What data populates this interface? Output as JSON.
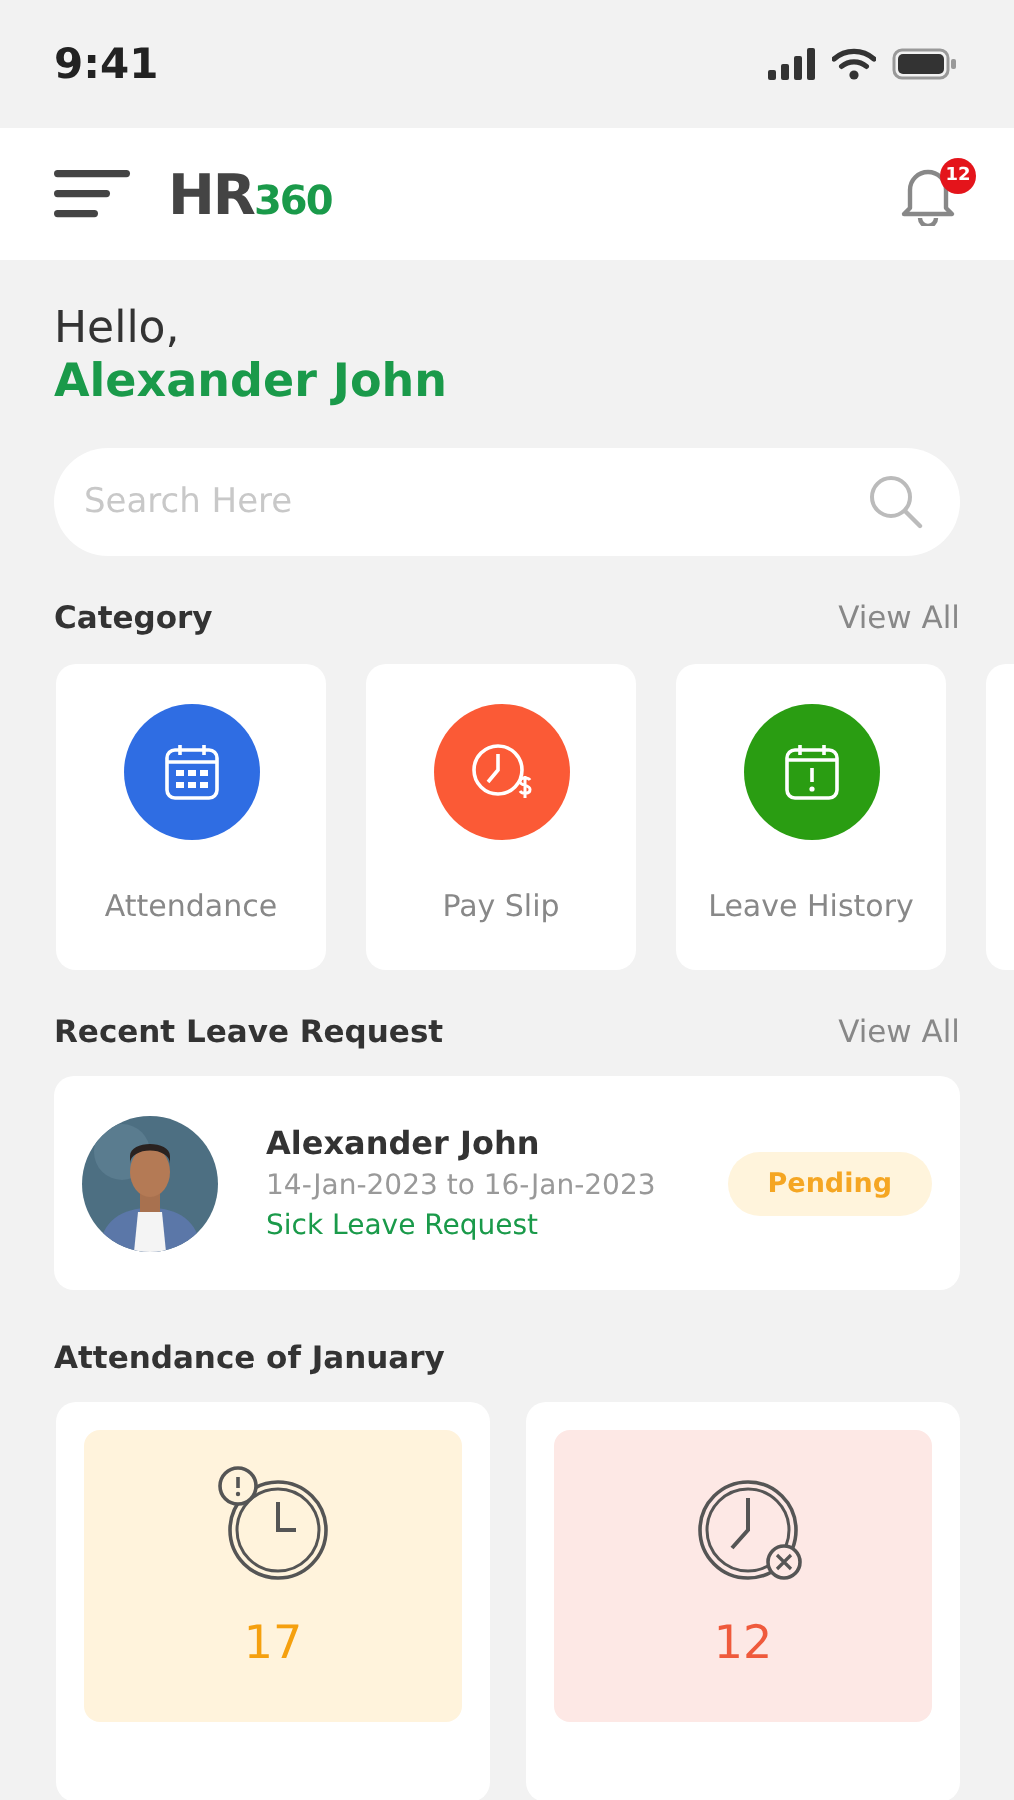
{
  "status_bar": {
    "time": "9:41"
  },
  "header": {
    "logo": {
      "text_1": "HR",
      "text_2": "360"
    },
    "notifications": "12"
  },
  "greeting": {
    "hello": "Hello,",
    "name": "Alexander John"
  },
  "search": {
    "placeholder": "Search Here"
  },
  "category": {
    "title": "Category",
    "view_all": "View All",
    "items": [
      {
        "label": "Attendance",
        "kind": "calendar",
        "color": "#2f6de3"
      },
      {
        "label": "Pay Slip",
        "kind": "payclock",
        "color": "#fb5a36"
      },
      {
        "label": "Leave History",
        "kind": "alertcal",
        "color": "#2a9d12"
      }
    ]
  },
  "recent_leave": {
    "title": "Recent Leave Request",
    "view_all": "View All",
    "requests": [
      {
        "name": "Alexander John",
        "dates": "14-Jan-2023 to 16-Jan-2023",
        "type": "Sick Leave Request",
        "status": "Pending"
      }
    ]
  },
  "attendance": {
    "title": "Attendance of January",
    "stats": [
      {
        "kind": "late",
        "value": "17",
        "color": "#f5a00f"
      },
      {
        "kind": "absent",
        "value": "12",
        "color": "#ef5a3c"
      }
    ]
  }
}
